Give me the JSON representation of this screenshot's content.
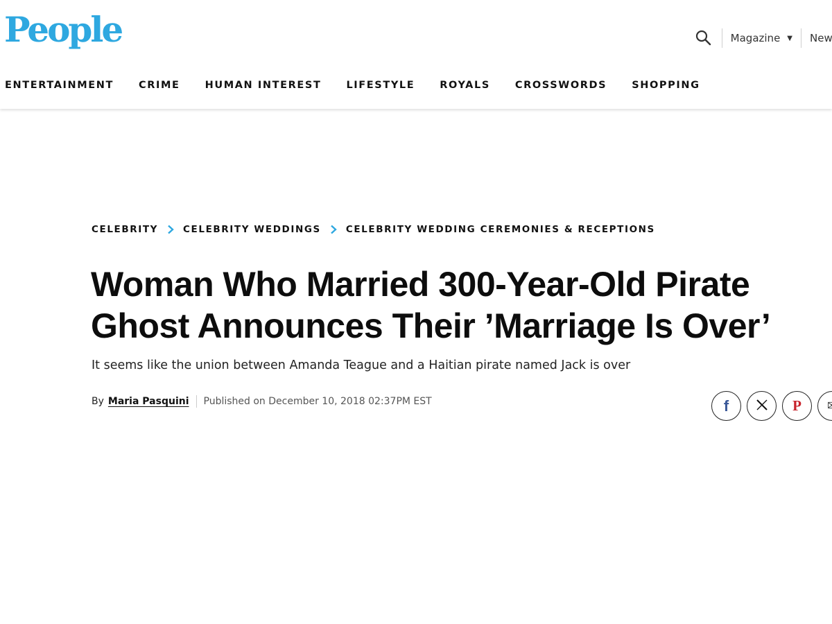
{
  "brand": {
    "logo_text": "People",
    "logo_color": "#2ea8e0"
  },
  "header": {
    "magazine_label": "Magazine",
    "newsletter_label": "Newsletters"
  },
  "nav": {
    "items": [
      {
        "label": "ENTERTAINMENT"
      },
      {
        "label": "CRIME"
      },
      {
        "label": "HUMAN INTEREST"
      },
      {
        "label": "LIFESTYLE"
      },
      {
        "label": "ROYALS"
      },
      {
        "label": "CROSSWORDS"
      },
      {
        "label": "SHOPPING"
      }
    ]
  },
  "breadcrumb": {
    "items": [
      {
        "label": "CELEBRITY"
      },
      {
        "label": "CELEBRITY WEDDINGS"
      },
      {
        "label": "CELEBRITY WEDDING CEREMONIES & RECEPTIONS"
      }
    ],
    "separator_color": "#2ea8e0"
  },
  "article": {
    "headline_line1": "Woman Who Married 300-Year-Old Pirate",
    "headline_line2": "Ghost Announces Their ’Marriage Is Over’",
    "subheadline": "It seems like the union between Amanda Teague and a Haitian pirate named Jack is over",
    "byline_prefix": "By",
    "author": "Maria Pasquini",
    "published": "Published on December 10, 2018 02:37PM EST"
  },
  "social": {
    "buttons": [
      {
        "icon": "facebook-icon",
        "glyph": "f",
        "color": "#3b5998"
      },
      {
        "icon": "x-icon",
        "glyph": "𝕏",
        "color": "#111111"
      },
      {
        "icon": "pinterest-icon",
        "glyph": "P",
        "color": "#c8232c"
      },
      {
        "icon": "email-icon",
        "glyph": "✉",
        "color": "#333333"
      }
    ]
  }
}
